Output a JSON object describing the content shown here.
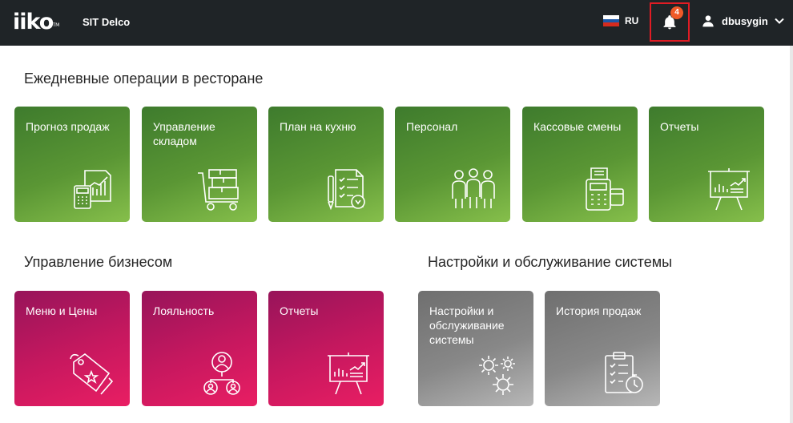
{
  "header": {
    "logo_text": "iiko",
    "logo_tm": "TM",
    "organization": "SIT Delco",
    "language": "RU",
    "notifications_count": "4",
    "username": "dbusygin",
    "flag_colors": [
      "#ffffff",
      "#1c57a7",
      "#d52b1e"
    ]
  },
  "sections": {
    "daily": {
      "title": "Ежедневные операции в ресторане",
      "tiles": [
        {
          "label": "Прогноз продаж",
          "icon": "sales-forecast-icon"
        },
        {
          "label": "Управление складом",
          "icon": "warehouse-cart-icon"
        },
        {
          "label": "План на кухню",
          "icon": "kitchen-plan-icon"
        },
        {
          "label": "Персонал",
          "icon": "staff-icon"
        },
        {
          "label": "Кассовые смены",
          "icon": "cash-register-icon"
        },
        {
          "label": "Отчеты",
          "icon": "report-board-icon"
        }
      ]
    },
    "business": {
      "title": "Управление бизнесом",
      "tiles": [
        {
          "label": "Меню и Цены",
          "icon": "price-tags-icon"
        },
        {
          "label": "Лояльность",
          "icon": "loyalty-people-icon"
        },
        {
          "label": "Отчеты",
          "icon": "report-board-icon"
        }
      ]
    },
    "system": {
      "title": "Настройки и обслуживание системы",
      "tiles": [
        {
          "label": "Настройки и обслуживание системы",
          "icon": "gears-icon"
        },
        {
          "label": "История продаж",
          "icon": "sales-history-icon"
        }
      ]
    }
  },
  "colors": {
    "topbar": "#1f2427",
    "highlight_border": "#e01c24",
    "badge": "#f05a28",
    "green_tile": "#5a9634",
    "pink_tile": "#c8185f",
    "gray_tile": "#888888"
  }
}
